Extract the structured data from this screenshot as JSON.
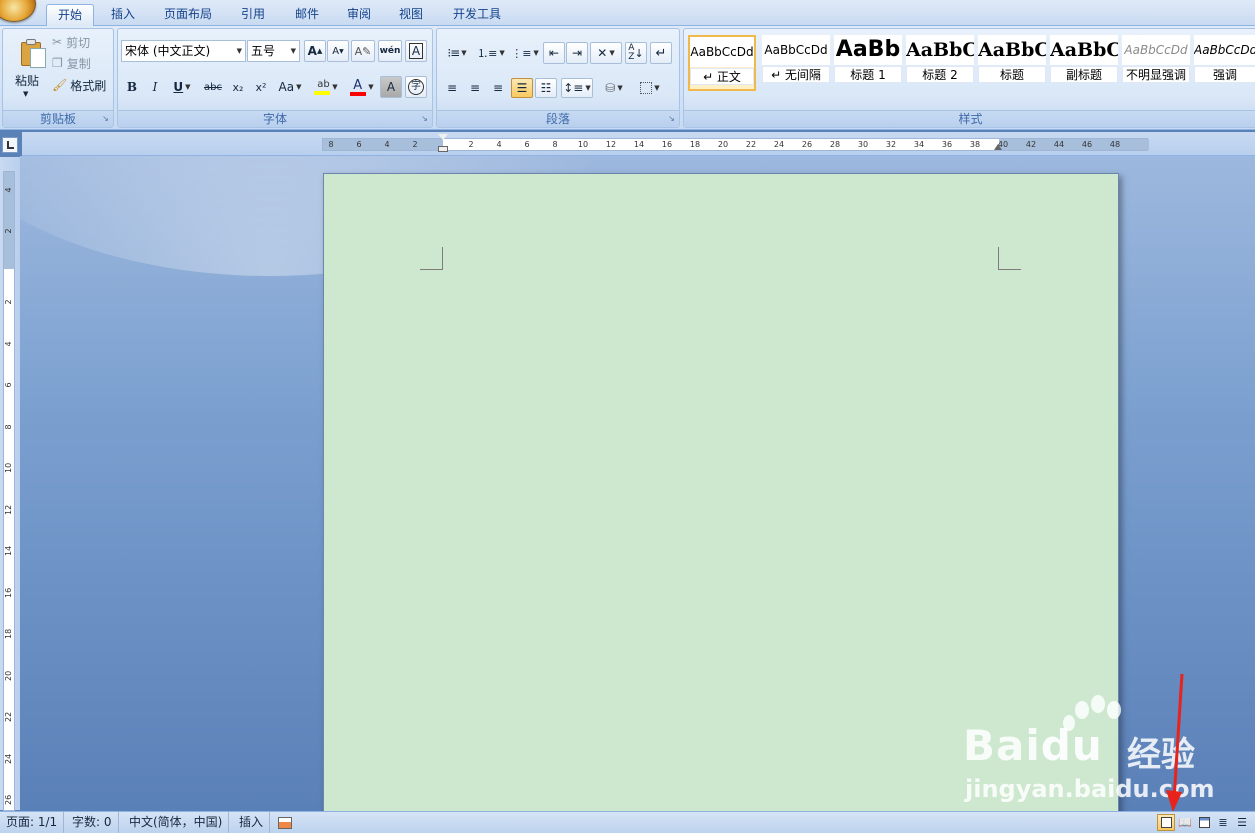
{
  "tabs": [
    "开始",
    "插入",
    "页面布局",
    "引用",
    "邮件",
    "审阅",
    "视图",
    "开发工具"
  ],
  "active_tab": "开始",
  "clipboard": {
    "paste": "粘贴",
    "cut": "剪切",
    "copy": "复制",
    "format_painter": "格式刷",
    "label": "剪贴板"
  },
  "font": {
    "font_name": "宋体 (中文正文)",
    "font_size": "五号",
    "label": "字体",
    "bold": "B",
    "italic": "I",
    "underline": "U",
    "strike": "abc",
    "subscript": "x₂",
    "superscript": "x²",
    "change_case": "Aa",
    "grow": "A",
    "shrink": "A",
    "font_color": "A",
    "char_shading": "A",
    "phonetic": "wén",
    "char_border": "A",
    "enclose": "字",
    "highlight_color": "#ffff00",
    "font_color_value": "#ff0000"
  },
  "paragraph": {
    "label": "段落"
  },
  "styles": {
    "label": "样式",
    "items": [
      {
        "sample": "AaBbCcDd",
        "name": "↵ 正文"
      },
      {
        "sample": "AaBbCcDd",
        "name": "↵ 无间隔"
      },
      {
        "sample": "AaBb",
        "name": "标题 1"
      },
      {
        "sample": "AaBbC",
        "name": "标题 2"
      },
      {
        "sample": "AaBbC",
        "name": "标题"
      },
      {
        "sample": "AaBbC",
        "name": "副标题"
      },
      {
        "sample": "AaBbCcDd",
        "name": "不明显强调"
      },
      {
        "sample": "AaBbCcDd",
        "name": "强调"
      }
    ]
  },
  "ruler": {
    "h_ticks": [
      "8",
      "6",
      "4",
      "2",
      "2",
      "4",
      "6",
      "8",
      "10",
      "12",
      "14",
      "16",
      "18",
      "20",
      "22",
      "24",
      "26",
      "28",
      "30",
      "32",
      "34",
      "36",
      "38",
      "40",
      "42",
      "44",
      "46",
      "48"
    ],
    "v_ticks": [
      "4",
      "2",
      "2",
      "4",
      "6",
      "8",
      "10",
      "12",
      "14",
      "16",
      "18",
      "20",
      "22",
      "24",
      "26"
    ]
  },
  "page_color": "#cde8cf",
  "watermark": {
    "brand": "Bai",
    "brand_du": "du",
    "brand_cn": "经验",
    "url": "jingyan.baidu.com"
  },
  "statusbar": {
    "page": "页面: 1/1",
    "words": "字数: 0",
    "language": "中文(简体，中国)",
    "mode": "插入"
  },
  "colors": {
    "accent_arrow": "#e8231c",
    "ribbon": "#dfeaf8",
    "workspace": "#5a82b6"
  }
}
